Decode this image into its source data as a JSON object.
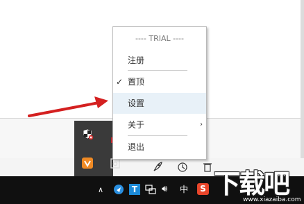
{
  "menu": {
    "header": "---- TRIAL ----",
    "items": [
      {
        "label": "注册"
      },
      {
        "label": "置顶",
        "checked": true
      },
      {
        "label": "设置",
        "highlighted": true
      },
      {
        "label": "关于",
        "submenu": true
      },
      {
        "label": "退出"
      }
    ]
  },
  "taskbar": {
    "ime_label": "中",
    "tray_app_label": "T"
  },
  "watermark": {
    "big": "下载吧",
    "small": "www.xiazaiba.com"
  },
  "colors": {
    "arrow": "#d42020",
    "menu_hover": "#e8f1f8",
    "taskbar": "#101010"
  }
}
